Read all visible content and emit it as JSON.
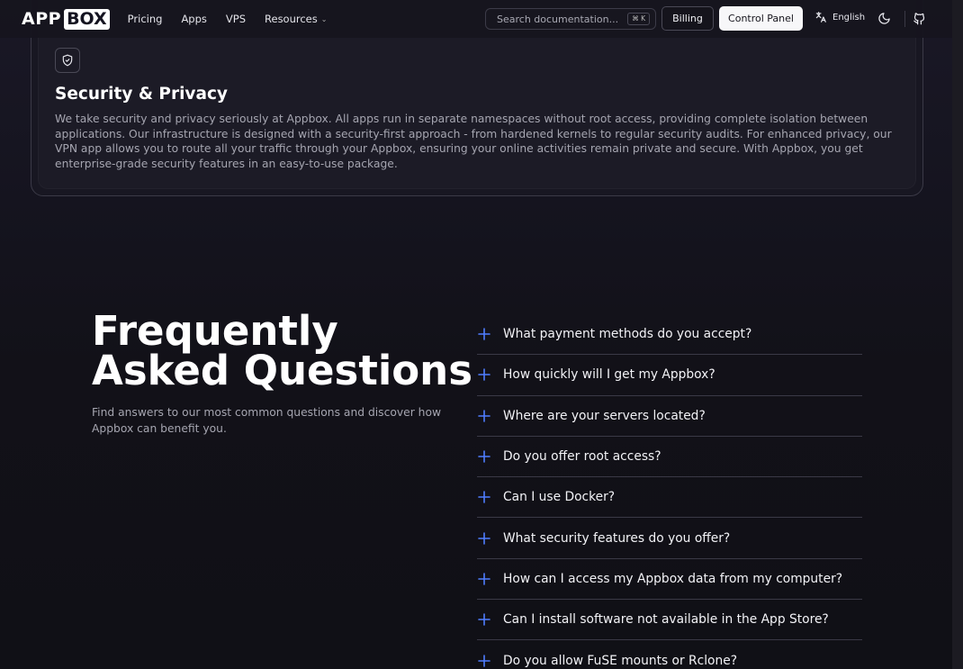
{
  "header": {
    "logo": {
      "part1": "APP",
      "part2": "BOX"
    },
    "nav": [
      {
        "label": "Pricing"
      },
      {
        "label": "Apps"
      },
      {
        "label": "VPS"
      },
      {
        "label": "Resources"
      }
    ],
    "search": {
      "placeholder": "Search documentation...",
      "shortcut": "⌘ K"
    },
    "billing_label": "Billing",
    "control_panel_label": "Control Panel",
    "language": "English"
  },
  "feature_card": {
    "title": "Security & Privacy",
    "description": "We take security and privacy seriously at Appbox. All apps run in separate namespaces without root access, providing complete isolation between applications. Our infrastructure is designed with a security-first approach - from hardened kernels to regular security audits. For enhanced privacy, our VPN app allows you to route all your traffic through your Appbox, ensuring your online activities remain private and secure. With Appbox, you get enterprise-grade security features in an easy-to-use package."
  },
  "faq": {
    "title": "Frequently Asked Questions",
    "subtitle": "Find answers to our most common questions and discover how Appbox can benefit you.",
    "questions": [
      "What payment methods do you accept?",
      "How quickly will I get my Appbox?",
      "Where are your servers located?",
      "Do you offer root access?",
      "Can I use Docker?",
      "What security features do you offer?",
      "How can I access my Appbox data from my computer?",
      "Can I install software not available in the App Store?",
      "Do you allow FuSE mounts or Rclone?"
    ]
  },
  "colors": {
    "accent": "#4f7dff",
    "background": "#12111a"
  }
}
